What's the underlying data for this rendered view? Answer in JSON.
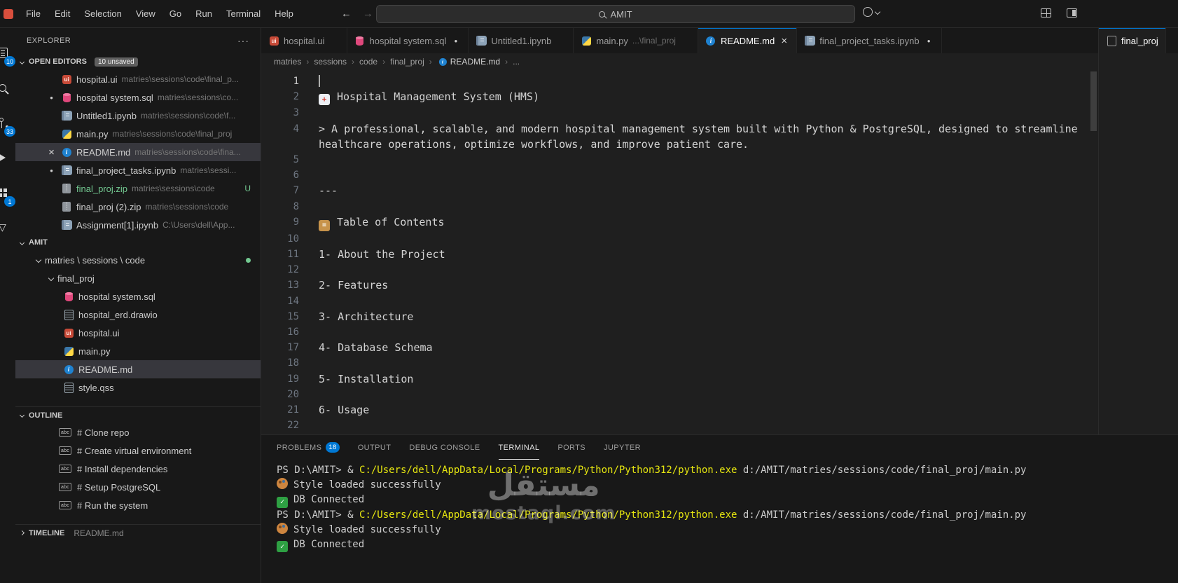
{
  "titlebar": {
    "menus": [
      "File",
      "Edit",
      "Selection",
      "View",
      "Go",
      "Run",
      "Terminal",
      "Help"
    ],
    "search_value": "AMIT"
  },
  "activity_bar": {
    "items": [
      {
        "icon": "files-icon",
        "badge": "10"
      },
      {
        "icon": "search-icon"
      },
      {
        "icon": "source-control-icon",
        "badge": "33"
      },
      {
        "icon": "run-debug-icon"
      },
      {
        "icon": "extensions-icon",
        "badge": "1"
      },
      {
        "icon": "testing-icon"
      }
    ]
  },
  "sidebar": {
    "title": "EXPLORER",
    "open_editors": {
      "header": "OPEN EDITORS",
      "badge": "10 unsaved",
      "items": [
        {
          "name": "hospital.ui",
          "path": "matries\\sessions\\code\\final_p...",
          "icon": "qt-file-icon"
        },
        {
          "name": "hospital system.sql",
          "path": "matries\\sessions\\co...",
          "icon": "database-icon",
          "cls": "dirty"
        },
        {
          "name": "Untitled1.ipynb",
          "path": "matries\\sessions\\code\\f...",
          "icon": "notebook-icon"
        },
        {
          "name": "main.py",
          "path": "matries\\sessions\\code\\final_proj",
          "icon": "python-icon"
        },
        {
          "name": "README.md",
          "path": "matries\\sessions\\code\\fina...",
          "icon": "info-icon",
          "cls": "close",
          "row_cls": "selected"
        },
        {
          "name": "final_project_tasks.ipynb",
          "path": "matries\\sessi...",
          "icon": "notebook-icon",
          "cls": "dirty"
        },
        {
          "name": "final_proj.zip",
          "path": "matries\\sessions\\code",
          "icon": "archive-icon",
          "name_cls": "git-green",
          "badge": "U"
        },
        {
          "name": "final_proj (2).zip",
          "path": "matries\\sessions\\code",
          "icon": "archive-icon"
        },
        {
          "name": "Assignment[1].ipynb",
          "path": "C:\\Users\\dell\\App...",
          "icon": "notebook-icon"
        }
      ]
    },
    "tree": {
      "header": "AMIT",
      "root_label": "matries \\ sessions \\ code",
      "folder": "final_proj",
      "files": [
        {
          "name": "hospital system.sql",
          "icon": "database-icon"
        },
        {
          "name": "hospital_erd.drawio",
          "icon": "drawio-icon"
        },
        {
          "name": "hospital.ui",
          "icon": "qt-file-icon"
        },
        {
          "name": "main.py",
          "icon": "python-icon"
        },
        {
          "name": "README.md",
          "icon": "info-icon",
          "row_cls": "selected"
        },
        {
          "name": "style.qss",
          "icon": "qss-file-icon"
        }
      ]
    },
    "outline": {
      "header": "OUTLINE",
      "items": [
        "# Clone repo",
        "# Create virtual environment",
        "# Install dependencies",
        "# Setup PostgreSQL",
        "# Run the system"
      ]
    },
    "timeline": {
      "header": "TIMELINE",
      "desc": "README.md"
    }
  },
  "editor": {
    "tabs": [
      {
        "label": "hospital.ui",
        "icon": "qt-file-icon"
      },
      {
        "label": "hospital system.sql",
        "icon": "database-icon",
        "decor": "dirty"
      },
      {
        "label": "Untitled1.ipynb",
        "icon": "notebook-icon"
      },
      {
        "label": "main.py",
        "desc": "...\\final_proj",
        "icon": "python-icon"
      },
      {
        "label": "README.md",
        "icon": "info-icon",
        "decor": "close",
        "cls": "active"
      },
      {
        "label": "final_project_tasks.ipynb",
        "icon": "notebook-icon",
        "decor": "dirty"
      }
    ],
    "tabs2": [
      {
        "label": "final_proj",
        "icon": "file-icon",
        "cls": "active"
      }
    ],
    "breadcrumbs": [
      "matries",
      "sessions",
      "code",
      "final_proj"
    ],
    "breadcrumb_file": "README.md",
    "breadcrumb_more": "...",
    "lines": [
      {
        "n": "1",
        "text": "",
        "cursor": true,
        "cls": "cur"
      },
      {
        "n": "2",
        "icon": "hospital-emoji",
        "text": "Hospital Management System (HMS)"
      },
      {
        "n": "3",
        "text": ""
      },
      {
        "n": "4",
        "text": "> A professional, scalable, and modern hospital management system built with Python & PostgreSQL, designed to streamline healthcare operations, optimize workflows, and improve patient care."
      },
      {
        "n": "5",
        "text": ""
      },
      {
        "n": "6",
        "text": ""
      },
      {
        "n": "7",
        "text": "---"
      },
      {
        "n": "8",
        "text": ""
      },
      {
        "n": "9",
        "icon": "clipboard-emoji",
        "text": "Table of Contents"
      },
      {
        "n": "10",
        "text": ""
      },
      {
        "n": "11",
        "text": "1- About the Project"
      },
      {
        "n": "12",
        "text": ""
      },
      {
        "n": "13",
        "text": "2- Features"
      },
      {
        "n": "14",
        "text": ""
      },
      {
        "n": "15",
        "text": "3- Architecture"
      },
      {
        "n": "16",
        "text": ""
      },
      {
        "n": "17",
        "text": "4- Database Schema"
      },
      {
        "n": "18",
        "text": ""
      },
      {
        "n": "19",
        "text": "5- Installation"
      },
      {
        "n": "20",
        "text": ""
      },
      {
        "n": "21",
        "text": "6- Usage"
      },
      {
        "n": "22",
        "text": ""
      }
    ]
  },
  "panel": {
    "tabs": [
      {
        "label": "PROBLEMS",
        "badge": "18"
      },
      {
        "label": "OUTPUT"
      },
      {
        "label": "DEBUG CONSOLE"
      },
      {
        "label": "TERMINAL",
        "cls": "active"
      },
      {
        "label": "PORTS"
      },
      {
        "label": "JUPYTER"
      }
    ],
    "terminal_lines": [
      {
        "segments": [
          {
            "text": "PS D:\\AMIT> ",
            "color": "plain"
          },
          {
            "text": "& ",
            "color": "plain"
          },
          {
            "text": "C:/Users/dell/AppData/Local/Programs/Python/Python312/python.exe",
            "color": "yellow"
          },
          {
            "text": " d:/AMIT/matries/sessions/code/final_proj/main.py",
            "color": "plain"
          }
        ]
      },
      {
        "icon": "palette-emoji",
        "segments": [
          {
            "text": "Style loaded successfully",
            "color": "plain"
          }
        ]
      },
      {
        "icon": "check-emoji",
        "segments": [
          {
            "text": "DB Connected",
            "color": "plain"
          }
        ]
      },
      {
        "segments": [
          {
            "text": "PS D:\\AMIT> ",
            "color": "plain"
          },
          {
            "text": "& ",
            "color": "plain"
          },
          {
            "text": "C:/Users/dell/AppData/Local/Programs/Python/Python312/python.exe",
            "color": "yellow"
          },
          {
            "text": " d:/AMIT/matries/sessions/code/final_proj/main.py",
            "color": "plain"
          }
        ]
      },
      {
        "icon": "palette-emoji",
        "segments": [
          {
            "text": "Style loaded successfully",
            "color": "plain"
          }
        ]
      },
      {
        "icon": "check-emoji",
        "segments": [
          {
            "text": "DB Connected",
            "color": "plain"
          }
        ]
      }
    ]
  },
  "watermark": {
    "arabic": "مستقل",
    "latin": "mostaql.com"
  },
  "theme": {
    "accent": "#0078d4",
    "selection_bg": "#37373d",
    "git_green": "#73c991",
    "terminal_yellow": "#e5e510",
    "editor_bg": "#1f1f1f",
    "side_bg": "#181818"
  }
}
